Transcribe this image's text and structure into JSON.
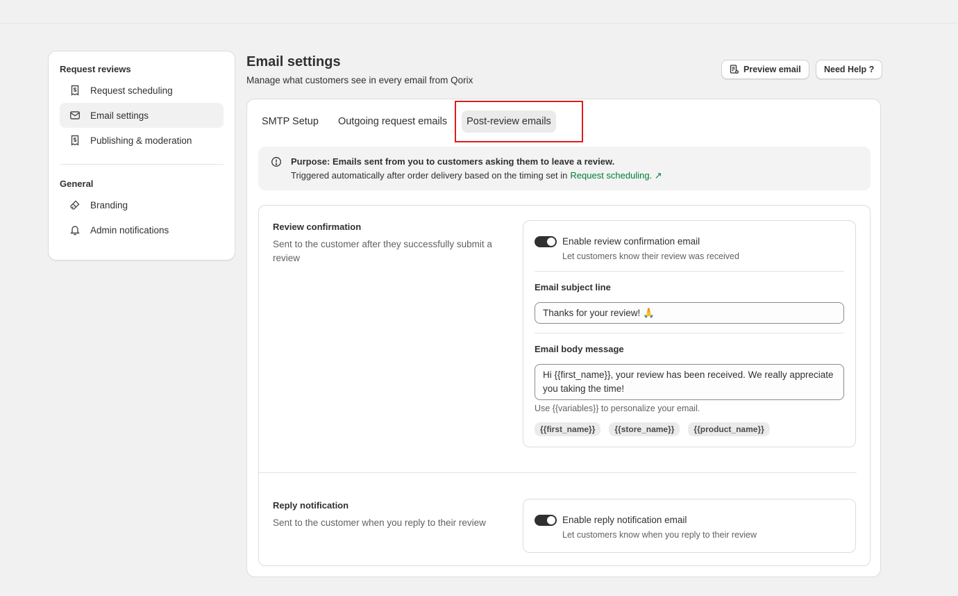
{
  "sidebar": {
    "sections": [
      {
        "title": "Request reviews",
        "items": [
          {
            "label": "Request scheduling",
            "icon": "receipt-dollar-icon"
          },
          {
            "label": "Email settings",
            "icon": "email-icon",
            "active": true
          },
          {
            "label": "Publishing & moderation",
            "icon": "receipt-dollar-icon"
          }
        ]
      },
      {
        "title": "General",
        "items": [
          {
            "label": "Branding",
            "icon": "paint-brush-icon"
          },
          {
            "label": "Admin notifications",
            "icon": "bell-icon"
          }
        ]
      }
    ]
  },
  "header": {
    "title": "Email settings",
    "subtitle": "Manage what customers see in every email from Qorix",
    "preview_button": "Preview email",
    "help_button": "Need Help ?"
  },
  "tabs": [
    {
      "label": "SMTP Setup"
    },
    {
      "label": "Outgoing request emails"
    },
    {
      "label": "Post-review emails",
      "active": true
    }
  ],
  "banner": {
    "title": "Purpose: Emails sent from you to customers asking them to leave a review.",
    "text": "Triggered automatically after order delivery based on the timing set in",
    "link": "Request scheduling. ↗"
  },
  "review_confirmation": {
    "title": "Review confirmation",
    "description": "Sent to the customer after they successfully submit a review",
    "toggle_label": "Enable review confirmation email",
    "toggle_help": "Let customers know their review was received",
    "enabled": true,
    "subject_label": "Email subject line",
    "subject_value": "Thanks for your review! 🙏",
    "body_label": "Email body message",
    "body_value": "Hi {{first_name}}, your review has been received. We really appreciate you taking the time!",
    "variables_help": "Use {{variables}} to personalize your email.",
    "variables": [
      "{{first_name}}",
      "{{store_name}}",
      "{{product_name}}"
    ]
  },
  "reply_notification": {
    "title": "Reply notification",
    "description": "Sent to the customer when you reply to their review",
    "toggle_label": "Enable reply notification email",
    "toggle_help": "Let customers know when you reply to their review",
    "enabled": true
  },
  "colors": {
    "link": "#007c33",
    "highlight": "#e01b1b",
    "toggle_on": "#303030"
  }
}
